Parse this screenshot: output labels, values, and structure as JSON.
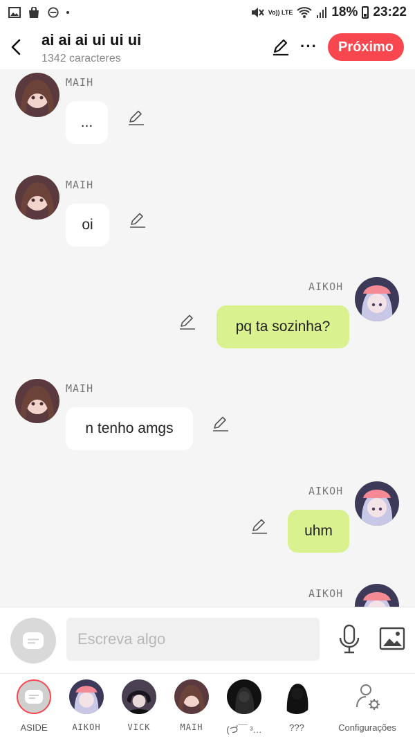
{
  "status_bar": {
    "battery": "18%",
    "time": "23:22",
    "network": "Vo)) LTE"
  },
  "header": {
    "title": "ai ai ai ui ui ui",
    "subtitle": "1342 caracteres",
    "next_label": "Próximo"
  },
  "messages": [
    {
      "side": "left",
      "author": "MAIH",
      "text": "..."
    },
    {
      "side": "left",
      "author": "MAIH",
      "text": "oi"
    },
    {
      "side": "right",
      "author": "AIKOH",
      "text": "pq ta sozinha?"
    },
    {
      "side": "left",
      "author": "MAIH",
      "text": "n tenho amgs"
    },
    {
      "side": "right",
      "author": "AIKOH",
      "text": "uhm"
    },
    {
      "side": "right",
      "author": "AIKOH",
      "text": ""
    }
  ],
  "composer": {
    "placeholder": "Escreva algo"
  },
  "characters": [
    {
      "label": "ASIDE"
    },
    {
      "label": "AIKOH"
    },
    {
      "label": "VICK"
    },
    {
      "label": "MAIH"
    },
    {
      "label": "(づ￣ ³…"
    },
    {
      "label": "???"
    },
    {
      "label": "Configurações"
    }
  ],
  "colors": {
    "accent": "#f8474f",
    "bubble_right": "#d9f28f",
    "bubble_left": "#ffffff",
    "background": "#f5f5f5"
  }
}
